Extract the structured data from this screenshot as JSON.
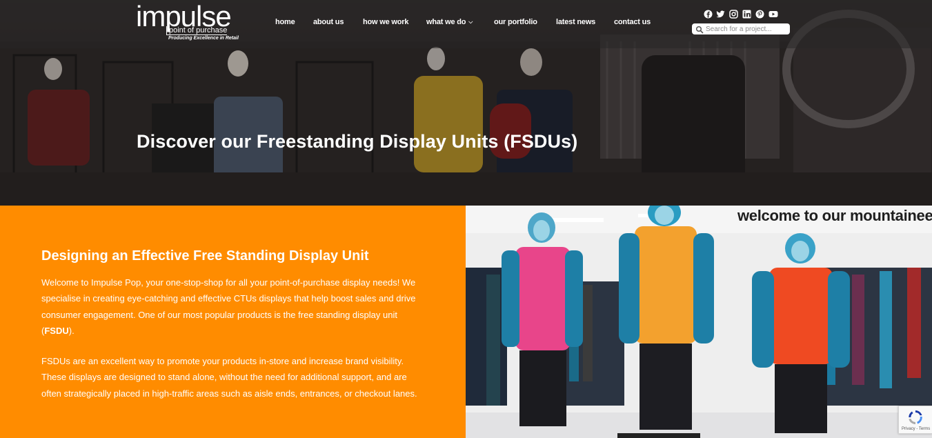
{
  "logo": {
    "word": "impulse",
    "sub": "point of purchase",
    "tagline": "Producing Excellence in Retail"
  },
  "nav": {
    "items": [
      {
        "label": "home"
      },
      {
        "label": "about us"
      },
      {
        "label": "how we work"
      },
      {
        "label": "what we do"
      },
      {
        "label": "our portfolio"
      },
      {
        "label": "latest news"
      },
      {
        "label": "contact us"
      }
    ]
  },
  "social": {
    "icons": [
      "facebook-icon",
      "twitter-icon",
      "instagram-icon",
      "linkedin-icon",
      "pinterest-icon",
      "youtube-icon"
    ]
  },
  "search": {
    "placeholder": "Search for a project..."
  },
  "hero": {
    "title": "Discover our Freestanding Display Units (FSDUs)"
  },
  "content": {
    "heading": "Designing an Effective Free Standing Display Unit",
    "para1_pre": "Welcome to Impulse Pop, your one-stop-shop for all your point-of-purchase display needs! We specialise in creating eye-catching and effective CTUs displays that help boost sales and drive consumer engagement. One of our most popular products is the free standing display unit (",
    "para1_bold": "FSDU",
    "para1_post": ").",
    "para2": "FSDUs are an excellent way to promote your products in-store and increase brand visibility. These displays are designed to stand alone, without the need for additional support, and are often strategically placed in high-traffic areas such as aisle ends, entrances, or checkout lanes."
  },
  "photo": {
    "sign": "welcome to our mountaineering"
  },
  "recaptcha": {
    "text": "Privacy - Terms"
  },
  "colors": {
    "accent": "#ff8c00",
    "text_light": "#ffffff"
  }
}
